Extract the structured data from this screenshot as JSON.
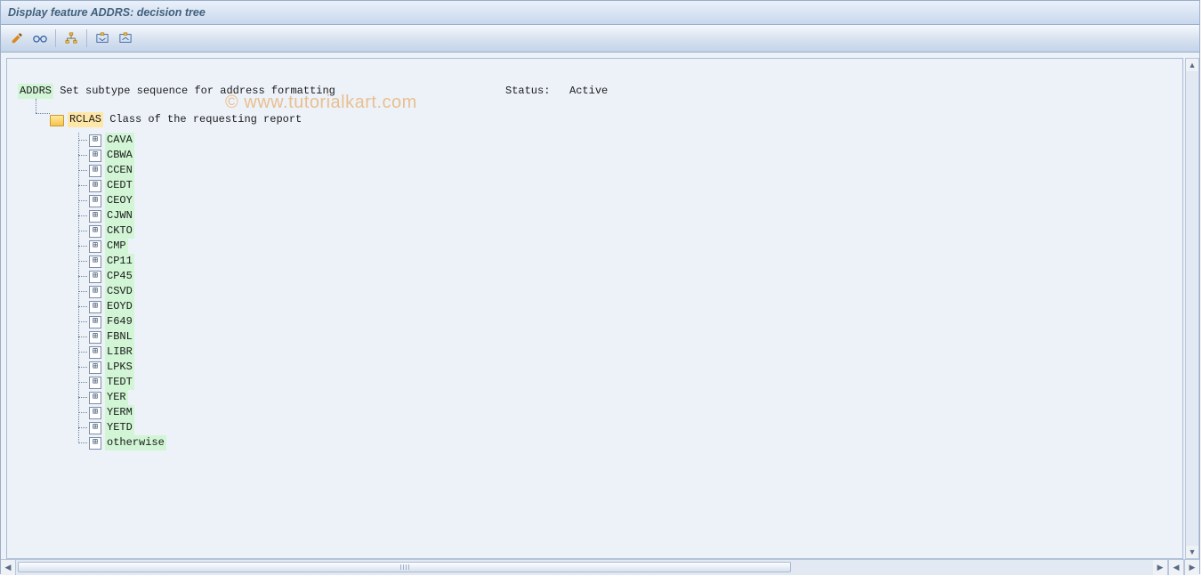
{
  "title": "Display feature ADDRS: decision tree",
  "watermark": "© www.tutorialkart.com",
  "toolbar": {
    "btn_edit": "edit-icon",
    "btn_check": "check-icon",
    "btn_structure": "structure-icon",
    "btn_expand": "expand-icon",
    "btn_collapse": "collapse-icon"
  },
  "root": {
    "code": "ADDRS",
    "desc": "Set subtype sequence for address formatting",
    "status_label": "Status:",
    "status_value": "Active"
  },
  "node": {
    "code": "RCLAS",
    "desc": "Class of the requesting report"
  },
  "leaves": [
    "CAVA",
    "CBWA",
    "CCEN",
    "CEDT",
    "CEOY",
    "CJWN",
    "CKTO",
    "CMP",
    "CP11",
    "CP45",
    "CSVD",
    "EOYD",
    "F649",
    "FBNL",
    "LIBR",
    "LPKS",
    "TEDT",
    "YER",
    "YERM",
    "YETD",
    "otherwise"
  ]
}
